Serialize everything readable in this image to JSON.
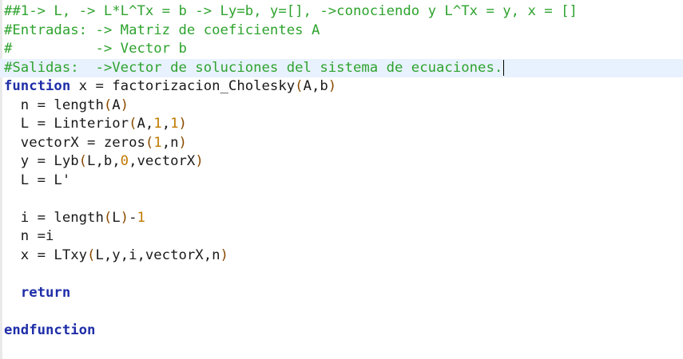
{
  "editor": {
    "lines": [
      {
        "kind": "comment",
        "tokens": [
          {
            "t": "comment",
            "v": "##1-> L, -> L*L^Tx = b -> Ly=b, y=[], ->conociendo y L^Tx = y, x = []"
          }
        ]
      },
      {
        "kind": "comment",
        "tokens": [
          {
            "t": "comment",
            "v": "#Entradas: -> Matriz de coeficientes A"
          }
        ]
      },
      {
        "kind": "comment",
        "tokens": [
          {
            "t": "comment",
            "v": "#          -> Vector b"
          }
        ]
      },
      {
        "kind": "comment",
        "current": true,
        "caret": true,
        "tokens": [
          {
            "t": "comment",
            "v": "#Salidas:  ->Vector de soluciones del sistema de ecuaciones."
          }
        ]
      },
      {
        "kind": "code",
        "tokens": [
          {
            "t": "keyword",
            "v": "function"
          },
          {
            "t": "ident",
            "v": " x = factorizacion_Cholesky"
          },
          {
            "t": "paren",
            "v": "("
          },
          {
            "t": "ident",
            "v": "A,b"
          },
          {
            "t": "paren",
            "v": ")"
          }
        ]
      },
      {
        "kind": "code",
        "tokens": [
          {
            "t": "ident",
            "v": "  n = length"
          },
          {
            "t": "paren",
            "v": "("
          },
          {
            "t": "ident",
            "v": "A"
          },
          {
            "t": "paren",
            "v": ")"
          }
        ]
      },
      {
        "kind": "code",
        "tokens": [
          {
            "t": "ident",
            "v": "  L = Linterior"
          },
          {
            "t": "paren",
            "v": "("
          },
          {
            "t": "ident",
            "v": "A,"
          },
          {
            "t": "number",
            "v": "1"
          },
          {
            "t": "ident",
            "v": ","
          },
          {
            "t": "number",
            "v": "1"
          },
          {
            "t": "paren",
            "v": ")"
          }
        ]
      },
      {
        "kind": "code",
        "tokens": [
          {
            "t": "ident",
            "v": "  vectorX = zeros"
          },
          {
            "t": "paren",
            "v": "("
          },
          {
            "t": "number",
            "v": "1"
          },
          {
            "t": "ident",
            "v": ",n"
          },
          {
            "t": "paren",
            "v": ")"
          }
        ]
      },
      {
        "kind": "code",
        "tokens": [
          {
            "t": "ident",
            "v": "  y = Lyb"
          },
          {
            "t": "paren",
            "v": "("
          },
          {
            "t": "ident",
            "v": "L,b,"
          },
          {
            "t": "number",
            "v": "0"
          },
          {
            "t": "ident",
            "v": ",vectorX"
          },
          {
            "t": "paren",
            "v": ")"
          }
        ]
      },
      {
        "kind": "code",
        "tokens": [
          {
            "t": "ident",
            "v": "  L = L'"
          }
        ]
      },
      {
        "kind": "blank",
        "tokens": [
          {
            "t": "ident",
            "v": ""
          }
        ]
      },
      {
        "kind": "code",
        "tokens": [
          {
            "t": "ident",
            "v": "  i = length"
          },
          {
            "t": "paren",
            "v": "("
          },
          {
            "t": "ident",
            "v": "L"
          },
          {
            "t": "paren",
            "v": ")"
          },
          {
            "t": "ident",
            "v": "-"
          },
          {
            "t": "number",
            "v": "1"
          }
        ]
      },
      {
        "kind": "code",
        "tokens": [
          {
            "t": "ident",
            "v": "  n =i"
          }
        ]
      },
      {
        "kind": "code",
        "tokens": [
          {
            "t": "ident",
            "v": "  x = LTxy"
          },
          {
            "t": "paren",
            "v": "("
          },
          {
            "t": "ident",
            "v": "L,y,i,vectorX,n"
          },
          {
            "t": "paren",
            "v": ")"
          }
        ]
      },
      {
        "kind": "blank",
        "tokens": [
          {
            "t": "ident",
            "v": ""
          }
        ]
      },
      {
        "kind": "code",
        "tokens": [
          {
            "t": "ident",
            "v": "  "
          },
          {
            "t": "keyword",
            "v": "return"
          }
        ]
      },
      {
        "kind": "blank",
        "tokens": [
          {
            "t": "ident",
            "v": ""
          }
        ]
      },
      {
        "kind": "code",
        "tokens": [
          {
            "t": "keyword",
            "v": "endfunction"
          }
        ]
      }
    ]
  },
  "colors": {
    "comment": "#2ea32e",
    "keyword": "#1f2ea8",
    "paren": "#8b4a00",
    "number": "#c07a00",
    "current_line": "#e8f2fe"
  }
}
